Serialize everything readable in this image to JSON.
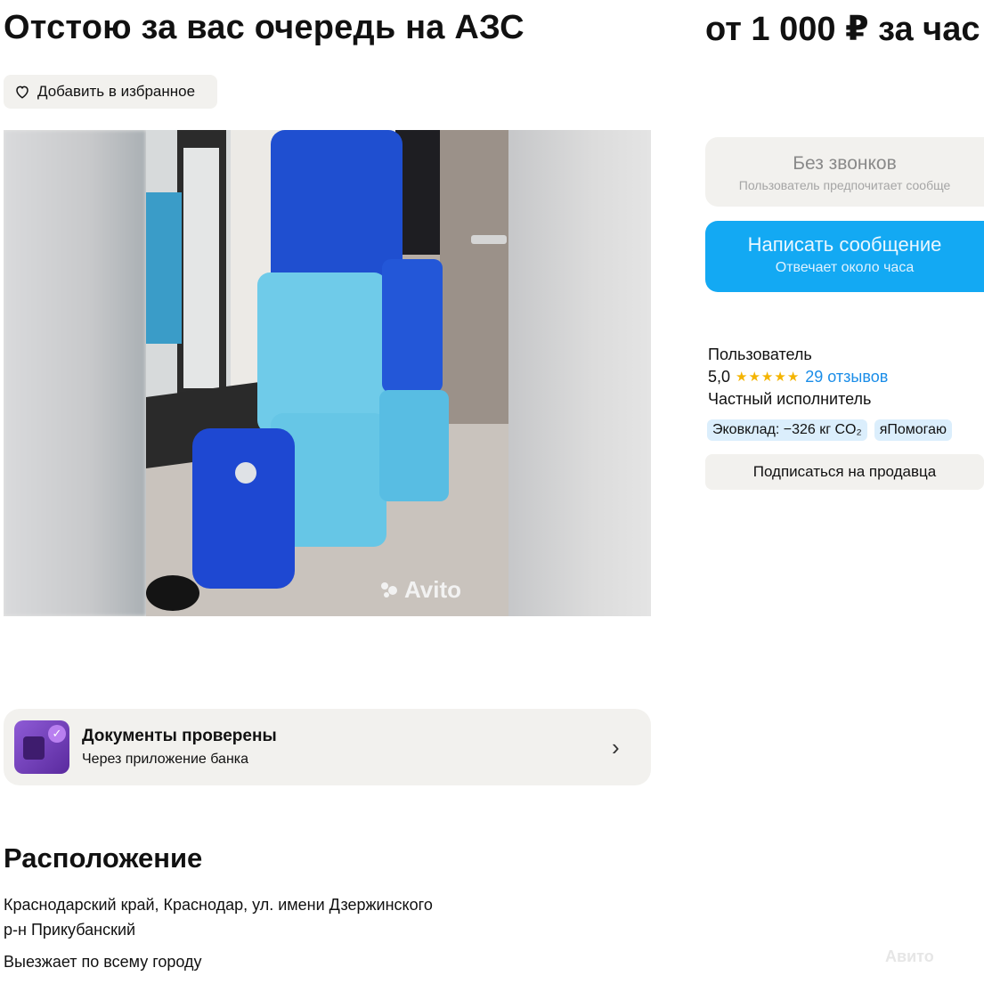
{
  "header": {
    "title": "Отстою за вас очередь на АЗС",
    "price": "от 1 000 ₽ за час"
  },
  "favorite": {
    "label": "Добавить в избранное",
    "icon": "heart-icon"
  },
  "photo": {
    "watermark": "Avito"
  },
  "contact": {
    "no_calls_title": "Без звонков",
    "no_calls_sub": "Пользователь предпочитает сообще",
    "message_button": "Написать сообщение",
    "message_sub": "Отвечает около часа",
    "accent": "#13a9f3"
  },
  "seller": {
    "name": "Пользователь",
    "rating": "5,0",
    "stars": "★★★★★",
    "reviews": "29 отзывов",
    "type": "Частный исполнитель",
    "badges": [
      "Эковклад: −326 кг CO₂",
      "яПомогаю"
    ],
    "subscribe": "Подписаться на продавца"
  },
  "documents": {
    "title": "Документы проверены",
    "subtitle": "Через приложение банка",
    "chevron": "›"
  },
  "location": {
    "heading": "Расположение",
    "address": "Краснодарский край, Краснодар, ул. имени Дзержинского",
    "district": "р-н Прикубанский",
    "note": "Выезжает по всему городу"
  },
  "footer_watermark": "Авито"
}
